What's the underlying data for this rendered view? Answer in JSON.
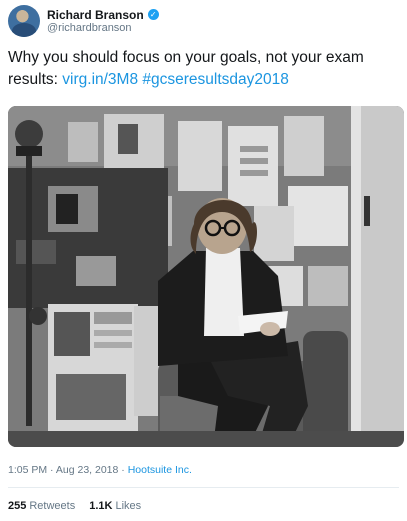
{
  "author": {
    "display_name": "Richard Branson",
    "handle": "@richardbranson",
    "verified_icon": "verified-badge-icon"
  },
  "tweet": {
    "text": "Why you should focus on your goals, not your exam results:",
    "link": "virg.in/3M8",
    "hashtag": "#gcseresultsday2018"
  },
  "photo": {
    "description_icon": "photo"
  },
  "meta": {
    "time": "1:05 PM",
    "separator": "·",
    "date": "Aug 23, 2018",
    "source": "Hootsuite Inc."
  },
  "stats": {
    "retweets_count": "255",
    "retweets_label": "Retweets",
    "likes_count": "1.1K",
    "likes_label": "Likes"
  },
  "colors": {
    "link": "#1b95e0",
    "verified": "#1da1f2",
    "muted": "#657786"
  }
}
